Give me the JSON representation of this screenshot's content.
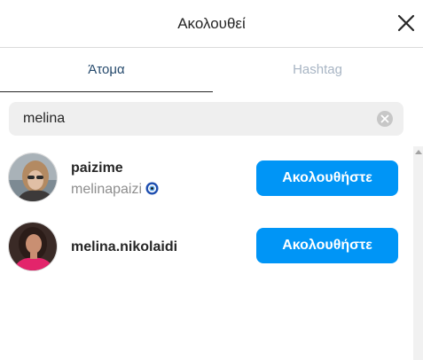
{
  "header": {
    "title": "Ακολουθεί"
  },
  "tabs": [
    {
      "label": "Άτομα",
      "active": true
    },
    {
      "label": "Hashtag",
      "active": false
    }
  ],
  "search": {
    "value": "melina"
  },
  "results": [
    {
      "username": "paizime",
      "full_name": "melinapaizi",
      "has_emoji": true,
      "button_label": "Ακολουθήστε"
    },
    {
      "username": "melina.nikolaidi",
      "full_name": "",
      "has_emoji": false,
      "button_label": "Ακολουθήστε"
    }
  ],
  "colors": {
    "accent": "#0095f6",
    "active_tab": "#264a6d",
    "inactive_tab": "#a8b5c4"
  }
}
